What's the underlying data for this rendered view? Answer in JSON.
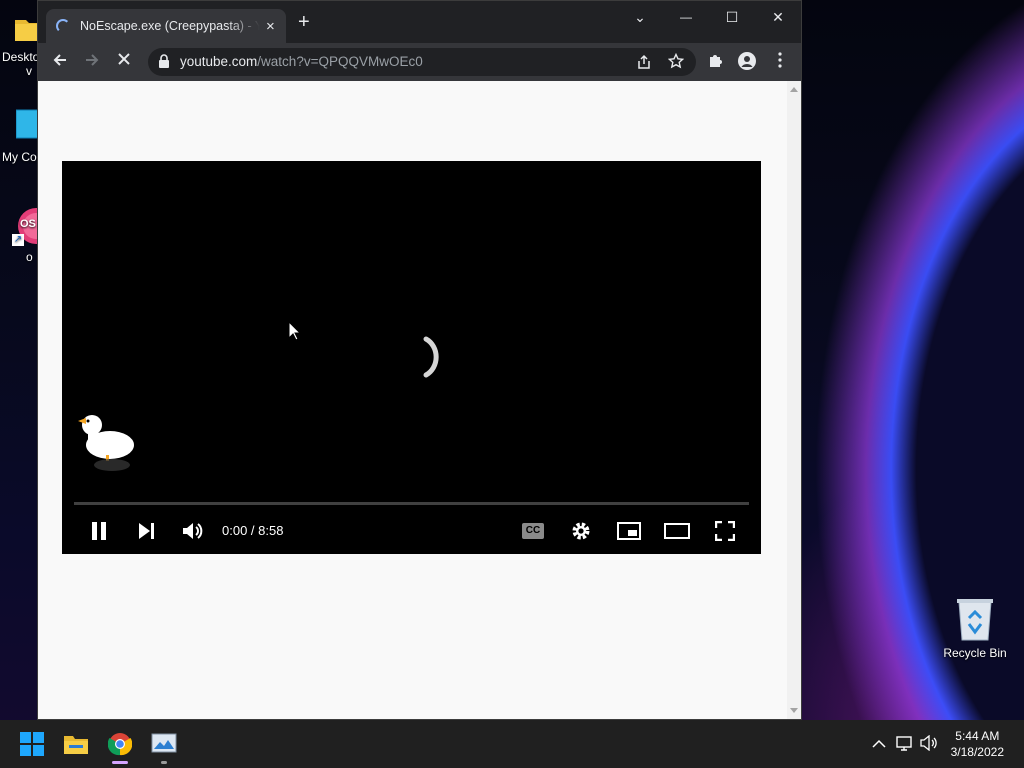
{
  "desktop": {
    "left_icons": [
      {
        "label": "Deskto",
        "label2": "v",
        "icon": "folder-icon"
      },
      {
        "label": "My Co",
        "icon": "computer-icon"
      },
      {
        "label": "o",
        "icon": "app-shortcut-icon",
        "badge": "OS"
      }
    ],
    "recycle_bin_label": "Recycle Bin"
  },
  "browser": {
    "tab_title": "NoEscape.exe (Creepypasta) - YouTube",
    "tab_close": "×",
    "new_tab": "+",
    "url_host": "youtube.com",
    "url_path": "/watch?v=QPQQVMwOEc0",
    "window_controls": {
      "tab_search": "⌄",
      "minimize": "—",
      "maximize": "☐",
      "close": "✕"
    }
  },
  "player": {
    "time": "0:00 / 8:58",
    "progress": 0.0,
    "cc_label": "CC"
  },
  "taskbar": {
    "clock_time": "5:44 AM",
    "clock_date": "3/18/2022"
  },
  "colors": {
    "accent": "#8ab4f8",
    "browser_frame": "#202124",
    "toolbar": "#35363a",
    "page_bg": "#f9f9f9",
    "player_bg": "#000000"
  }
}
